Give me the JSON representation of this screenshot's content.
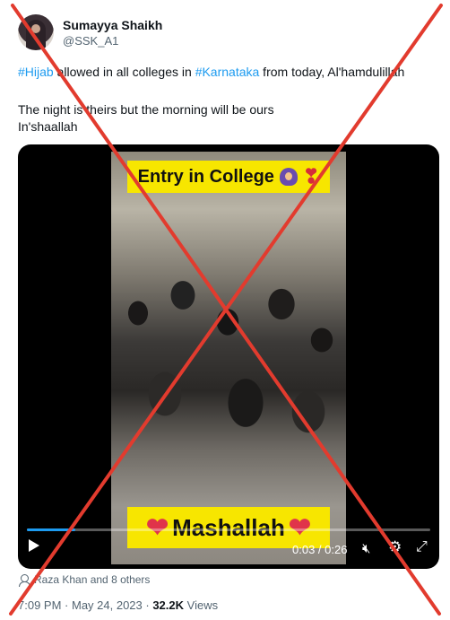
{
  "author": {
    "name": "Sumayya Shaikh",
    "handle": "@SSK_A1",
    "avatar": "avatar"
  },
  "tweet": {
    "line1": {
      "hashtag1": "#Hijab",
      "text1": " allowed in all colleges in ",
      "hashtag2": "#Karnataka",
      "text2": " from today, Al'hamdulillah"
    },
    "line2": "The night is theirs but the morning will be ours",
    "line3": "In'shaallah"
  },
  "video": {
    "caption_top": "Entry in College",
    "caption_bottom": "Mashallah",
    "time_display": "0:03 / 0:26",
    "progress": 0.12,
    "icons": [
      "play-icon",
      "volume-muted-icon",
      "settings-icon",
      "fullscreen-icon"
    ]
  },
  "liked_by": "Raza Khan and 8 others",
  "meta": {
    "time": "7:09 PM",
    "separator": " · ",
    "date": "May 24, 2023",
    "views_count": "32.2K",
    "views_label": " Views"
  },
  "overlay": {
    "cross_color": "#e23b2e"
  },
  "colors": {
    "link": "#1d9bf0",
    "secondary_text": "#536471",
    "caption_bg": "#f7e600"
  }
}
